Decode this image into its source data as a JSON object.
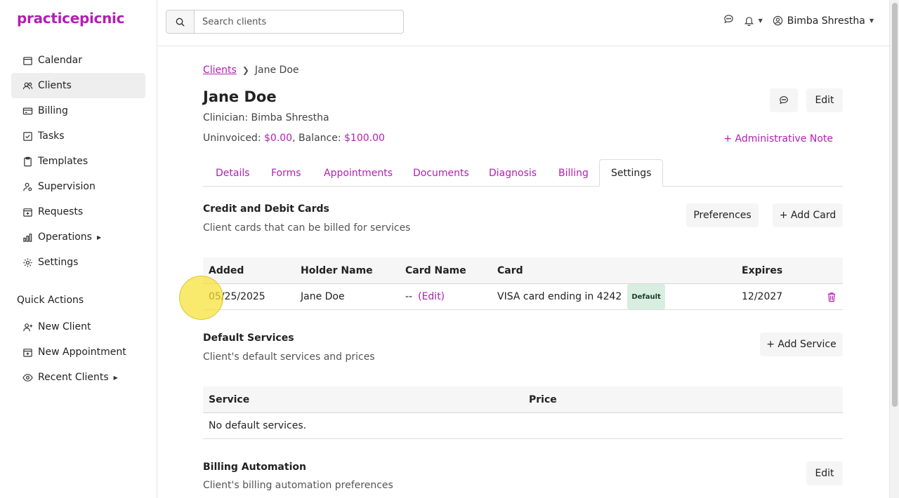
{
  "app": {
    "logo": "practicepicnic"
  },
  "sidebar": {
    "items": [
      {
        "label": "Calendar",
        "icon": "calendar-icon"
      },
      {
        "label": "Clients",
        "icon": "users-icon",
        "active": true
      },
      {
        "label": "Billing",
        "icon": "billing-icon"
      },
      {
        "label": "Tasks",
        "icon": "tasks-icon"
      },
      {
        "label": "Templates",
        "icon": "templates-icon"
      },
      {
        "label": "Supervision",
        "icon": "supervision-icon"
      },
      {
        "label": "Requests",
        "icon": "requests-icon"
      },
      {
        "label": "Operations",
        "icon": "operations-icon",
        "has_submenu": true
      },
      {
        "label": "Settings",
        "icon": "gear-icon"
      }
    ],
    "quick_actions_title": "Quick Actions",
    "quick_actions": [
      {
        "label": "New Client",
        "icon": "add-user-icon"
      },
      {
        "label": "New Appointment",
        "icon": "calendar-plus-icon"
      },
      {
        "label": "Recent Clients",
        "icon": "eye-icon",
        "has_submenu": true
      }
    ]
  },
  "header": {
    "search_placeholder": "Search clients",
    "user_name": "Bimba Shrestha"
  },
  "breadcrumb": {
    "parent": "Clients",
    "current": "Jane Doe"
  },
  "client": {
    "name": "Jane Doe",
    "clinician": "Clinician: Bimba Shrestha",
    "uninvoiced_label": "Uninvoiced: ",
    "uninvoiced": "$0.00",
    "balance_label": ", Balance: ",
    "balance": "$100.00",
    "edit_label": "Edit",
    "admin_note_label": "+ Administrative Note"
  },
  "tabs": [
    {
      "label": "Details"
    },
    {
      "label": "Forms"
    },
    {
      "label": "Appointments"
    },
    {
      "label": "Documents"
    },
    {
      "label": "Diagnosis"
    },
    {
      "label": "Billing"
    },
    {
      "label": "Settings",
      "active": true
    }
  ],
  "cards": {
    "title": "Credit and Debit Cards",
    "subtitle": "Client cards that can be billed for services",
    "preferences_label": "Preferences",
    "add_label": "+ Add Card",
    "columns": [
      "Added",
      "Holder Name",
      "Card Name",
      "Card",
      "Expires"
    ],
    "rows": [
      {
        "added": "05/25/2025",
        "holder": "Jane Doe",
        "card_name": "--",
        "card_name_edit": "(Edit)",
        "card": "VISA card ending in 4242",
        "badge": "Default",
        "expires": "12/2027"
      }
    ]
  },
  "services": {
    "title": "Default Services",
    "subtitle": "Client's default services and prices",
    "add_label": "+ Add Service",
    "columns": [
      "Service",
      "Price"
    ],
    "empty": "No default services."
  },
  "billing_automation": {
    "title": "Billing Automation",
    "subtitle": "Client's billing automation preferences",
    "edit_label": "Edit"
  },
  "colors": {
    "accent": "#b21fb3",
    "badge_bg": "#d8eee0",
    "cursor_highlight": "#f6e035"
  }
}
